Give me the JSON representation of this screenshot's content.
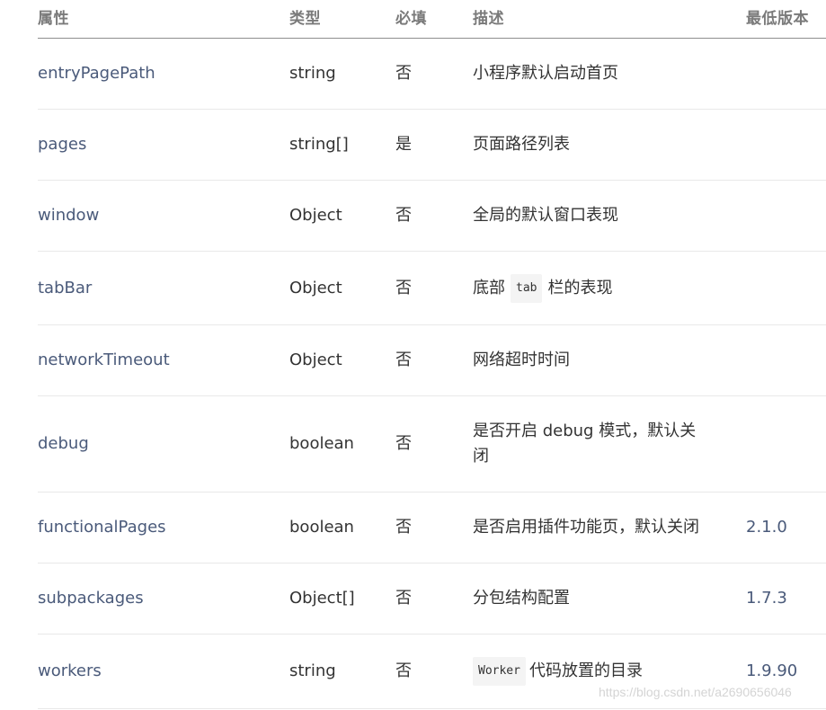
{
  "table": {
    "headers": {
      "prop": "属性",
      "type": "类型",
      "required": "必填",
      "desc": "描述",
      "version": "最低版本"
    },
    "rows": [
      {
        "prop": "entryPagePath",
        "type": "string",
        "required": "否",
        "desc": "小程序默认启动首页",
        "version": ""
      },
      {
        "prop": "pages",
        "type": "string[]",
        "required": "是",
        "desc": "页面路径列表",
        "version": ""
      },
      {
        "prop": "window",
        "type": "Object",
        "required": "否",
        "desc": "全局的默认窗口表现",
        "version": ""
      },
      {
        "prop": "tabBar",
        "type": "Object",
        "required": "否",
        "desc_before": "底部",
        "desc_code": "tab",
        "desc_after": "栏的表现",
        "version": ""
      },
      {
        "prop": "networkTimeout",
        "type": "Object",
        "required": "否",
        "desc": "网络超时时间",
        "version": ""
      },
      {
        "prop": "debug",
        "type": "boolean",
        "required": "否",
        "desc": "是否开启 debug 模式，默认关闭",
        "version": ""
      },
      {
        "prop": "functionalPages",
        "type": "boolean",
        "required": "否",
        "desc": "是否启用插件功能页，默认关闭",
        "version": "2.1.0"
      },
      {
        "prop": "subpackages",
        "type": "Object[]",
        "required": "否",
        "desc": "分包结构配置",
        "version": "1.7.3"
      },
      {
        "prop": "workers",
        "type": "string",
        "required": "否",
        "desc_code": "Worker",
        "desc_after": "代码放置的目录",
        "version": "1.9.90"
      }
    ]
  },
  "watermark": "https://blog.csdn.net/a2690656046"
}
